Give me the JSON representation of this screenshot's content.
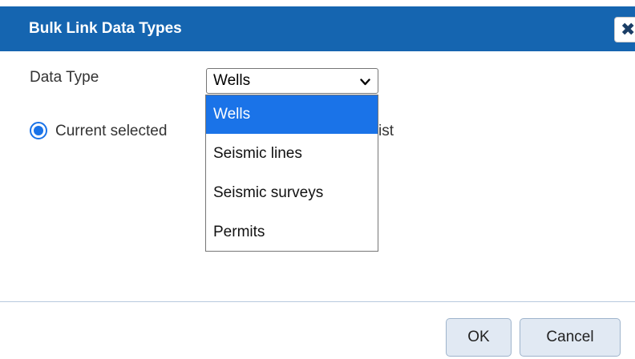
{
  "dialog": {
    "title": "Bulk Link Data Types",
    "close_icon": "close-icon"
  },
  "form": {
    "data_type_label": "Data Type",
    "data_type_selected": "Wells",
    "dropdown_options": [
      "Wells",
      "Seismic lines",
      "Seismic surveys",
      "Permits"
    ],
    "radio_label_visible": "Current selected",
    "radio_label_tail": "ist"
  },
  "footer": {
    "ok_label": "OK",
    "cancel_label": "Cancel"
  },
  "colors": {
    "titlebar": "#1565b0",
    "accent": "#1a73e8",
    "button_bg": "#e1e9f3"
  }
}
